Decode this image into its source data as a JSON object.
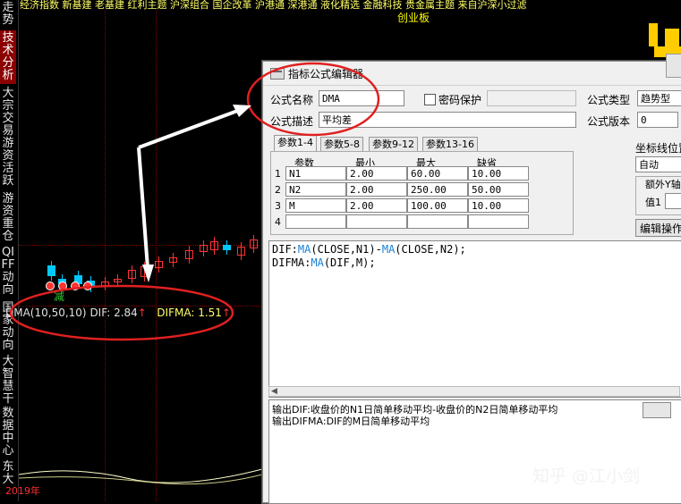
{
  "ticker": "经济指数 新基建 老基建 红利主题 沪深组合 国企改革 沪港通 深港通 液化精选 金融科技 贵金属主题 来自沪深小过滤",
  "chart_title": "创业板",
  "leftnav": [
    {
      "label": "走势",
      "active": false
    },
    {
      "label": "技术分析",
      "active": true
    },
    {
      "label": "大宗交易",
      "active": false
    },
    {
      "label": "游资活跃",
      "active": false
    },
    {
      "label": "游资重仓",
      "active": false
    },
    {
      "label": "QIFF动向",
      "active": false
    },
    {
      "label": "国家动向",
      "active": false
    },
    {
      "label": "大智慧干",
      "active": false
    },
    {
      "label": "数据中心",
      "active": false
    },
    {
      "label": "东大",
      "active": false
    }
  ],
  "indicator": {
    "name": "DMA(10,50,10)",
    "dif_label": "DIF:",
    "dif_value": "2.84",
    "difma_label": "DIFMA:",
    "difma_value": "1.51",
    "arrow": "↑"
  },
  "sell_label": "减",
  "year_label": "2019年",
  "dialog": {
    "title": "指标公式编辑器",
    "formula_name_label": "公式名称",
    "formula_name_value": "DMA",
    "password_label": "密码保护",
    "formula_desc_label": "公式描述",
    "formula_desc_value": "平均差",
    "formula_type_label": "公式类型",
    "formula_type_value": "趋势型",
    "formula_version_label": "公式版本",
    "formula_version_value": "0",
    "tabs": [
      "参数1-4",
      "参数5-8",
      "参数9-12",
      "参数13-16"
    ],
    "param_headers": [
      "参数",
      "最小",
      "最大",
      "缺省"
    ],
    "params": [
      {
        "row": "1",
        "name": "N1",
        "min": "2.00",
        "max": "60.00",
        "default": "10.00"
      },
      {
        "row": "2",
        "name": "N2",
        "min": "2.00",
        "max": "250.00",
        "default": "50.00"
      },
      {
        "row": "3",
        "name": "M",
        "min": "2.00",
        "max": "100.00",
        "default": "10.00"
      },
      {
        "row": "4",
        "name": "",
        "min": "",
        "max": "",
        "default": ""
      }
    ],
    "axis_pos_label": "坐标线位置",
    "axis_pos_value": "自动",
    "extra_y_label": "额外Y轴",
    "value1_label": "值1",
    "edit_ops_button": "编辑操作",
    "code": [
      {
        "parts": [
          [
            "DIF:",
            "t"
          ],
          [
            "MA",
            "f"
          ],
          [
            "(CLOSE,N1)-",
            "t"
          ],
          [
            "MA",
            "f"
          ],
          [
            "(CLOSE,N2);",
            "t"
          ]
        ]
      },
      {
        "parts": [
          [
            "DIFMA:",
            "t"
          ],
          [
            "MA",
            "f"
          ],
          [
            "(DIF,M);",
            "t"
          ]
        ]
      }
    ],
    "description": [
      "输出DIF:收盘价的N1日简单移动平均-收盘价的N2日简单移动平均",
      "输出DIFMA:DIF的M日简单移动平均"
    ]
  },
  "watermark": "知乎 @江小剑",
  "colors": {
    "up": "#ff3333",
    "down": "#00c8ff",
    "annotation": "#e02020",
    "nav_active": "#8b0000"
  }
}
